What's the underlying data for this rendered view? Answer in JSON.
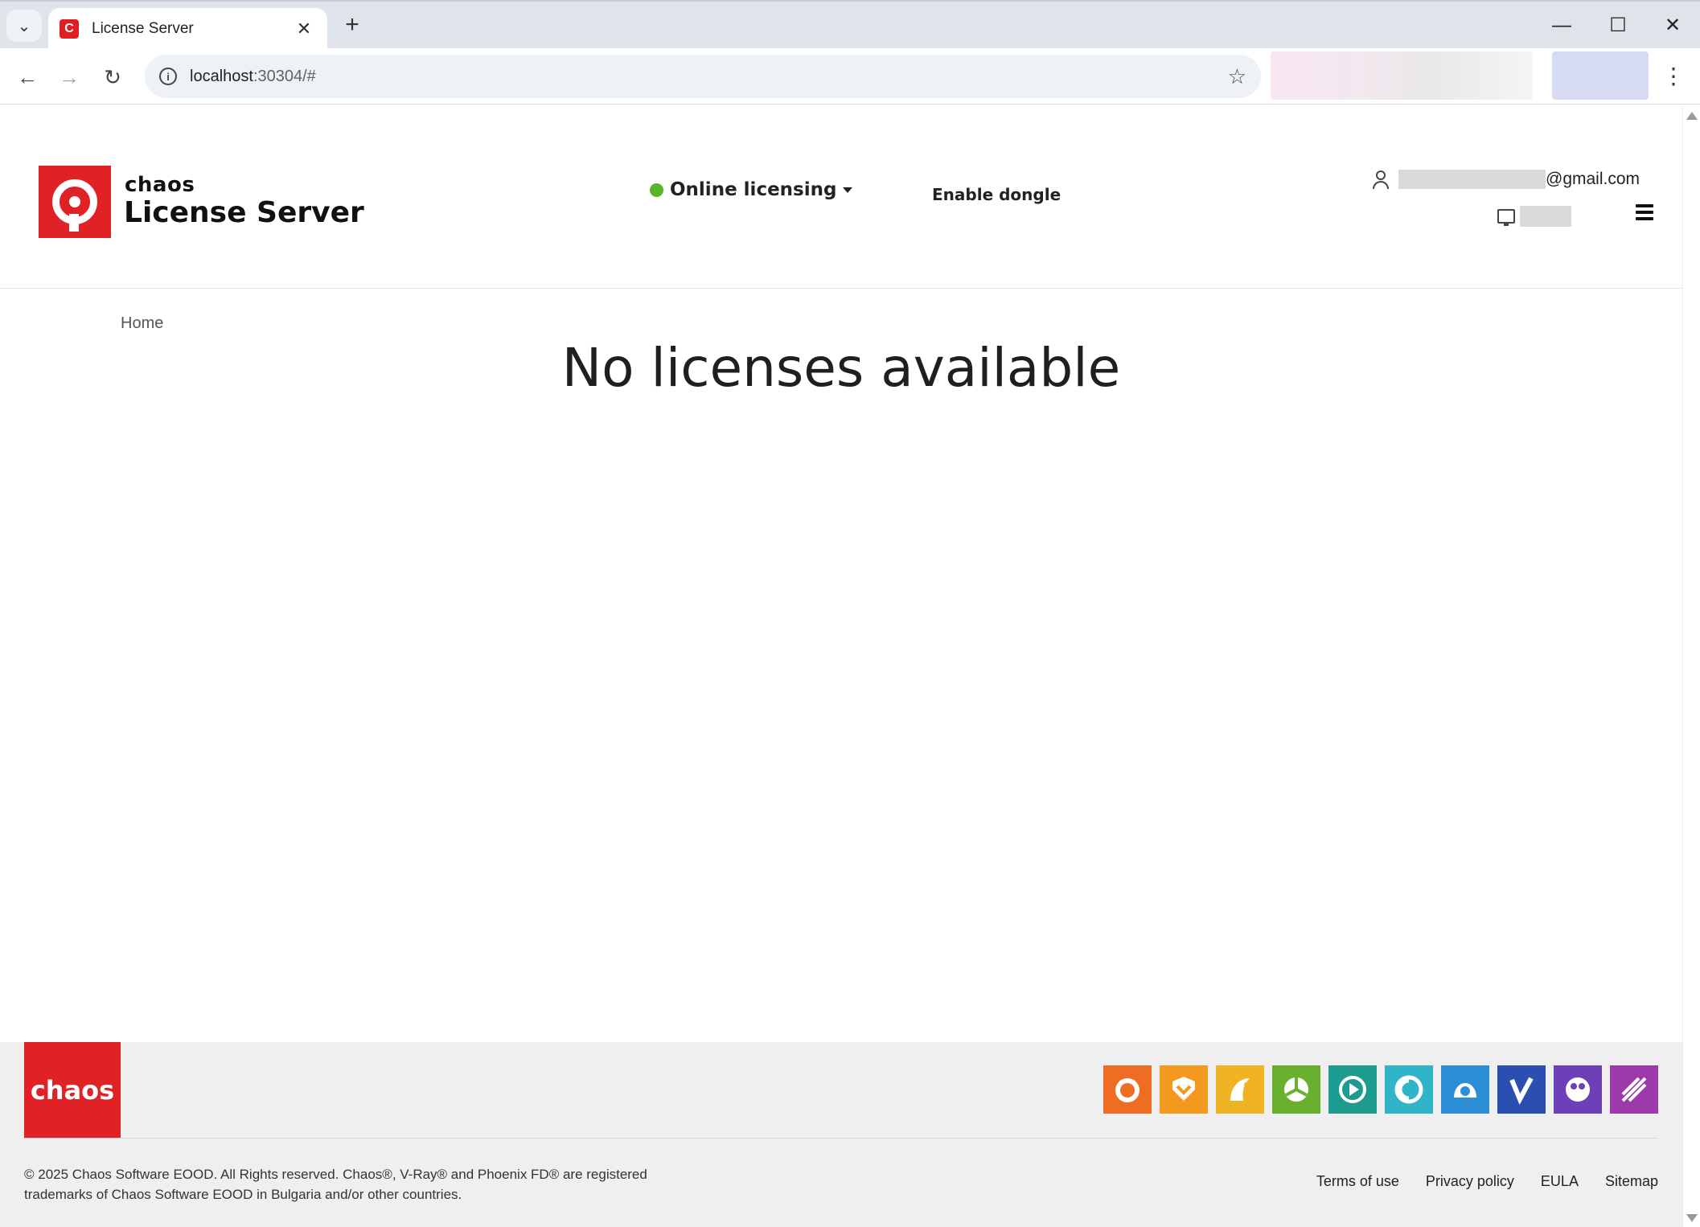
{
  "browser": {
    "tab_title": "License Server",
    "tab_favicon": "C",
    "url_host": "localhost",
    "url_rest": ":30304/#"
  },
  "header": {
    "brand_small": "chaos",
    "brand_big": "License Server",
    "licensing_mode": "Online licensing",
    "status_color": "#5bb52a",
    "enable_dongle": "Enable dongle",
    "email_suffix": "@gmail.com"
  },
  "main": {
    "breadcrumb": "Home",
    "message": "No licenses available"
  },
  "footer": {
    "logo_text": "chaos",
    "product_icons": [
      {
        "name": "vray-icon",
        "color": "#ef6c23"
      },
      {
        "name": "corona-icon",
        "color": "#f39a1e"
      },
      {
        "name": "phoenix-icon",
        "color": "#f0b323"
      },
      {
        "name": "cosmos-icon",
        "color": "#6ab02f"
      },
      {
        "name": "vantage-icon",
        "color": "#1e9b8f"
      },
      {
        "name": "cylindo-icon",
        "color": "#2fb4c9"
      },
      {
        "name": "cloud-icon",
        "color": "#2c8fd6"
      },
      {
        "name": "vision-icon",
        "color": "#2a4fb0"
      },
      {
        "name": "player-icon",
        "color": "#6e40b8"
      },
      {
        "name": "scans-icon",
        "color": "#9b3aa8"
      }
    ],
    "copyright_line1": "© 2025 Chaos Software EOOD. All Rights reserved. Chaos®, V-Ray® and Phoenix FD® are registered",
    "copyright_line2": "trademarks of Chaos Software EOOD in Bulgaria and/or other countries.",
    "links": {
      "terms": "Terms of use",
      "privacy": "Privacy policy",
      "eula": "EULA",
      "sitemap": "Sitemap"
    }
  }
}
